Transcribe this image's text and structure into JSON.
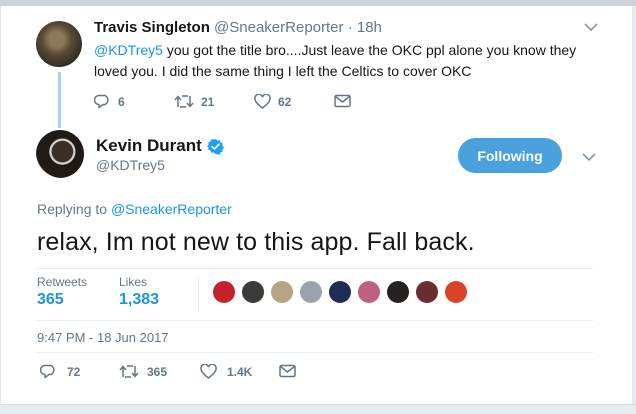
{
  "parent_tweet": {
    "name": "Travis Singleton",
    "handle": "@SneakerReporter",
    "separator": "·",
    "time": "18h",
    "mention": "@KDTrey5",
    "text_line1_rest": " you got the title bro....Just leave the OKC ppl alone you know they",
    "text_line2": "loved you. I did the same thing I left the Celtics to cover OKC",
    "replies": "6",
    "retweets": "21",
    "likes": "62"
  },
  "main_tweet": {
    "name": "Kevin Durant",
    "handle": "@KDTrey5",
    "follow_button": "Following",
    "replying_prefix": "Replying to ",
    "replying_to": "@SneakerReporter",
    "text": "relax, Im not new to this app. Fall back.",
    "retweets_label": "Retweets",
    "retweets_count": "365",
    "likes_label": "Likes",
    "likes_count": "1,383",
    "timestamp": "9:47 PM - 18 Jun 2017",
    "replies": "72",
    "retweets": "365",
    "likes": "1.4K"
  },
  "liker_avatar_colors": [
    "#c4222b",
    "#3d3b3a",
    "#b8a384",
    "#9aa3ad",
    "#1f2d56",
    "#c0607f",
    "#262220",
    "#6a2d31",
    "#d8442a"
  ],
  "colors": {
    "accent": "#1b95e0",
    "follow_button": "#4aa1de",
    "thread_line": "#a9d2f2",
    "muted": "#657786"
  }
}
